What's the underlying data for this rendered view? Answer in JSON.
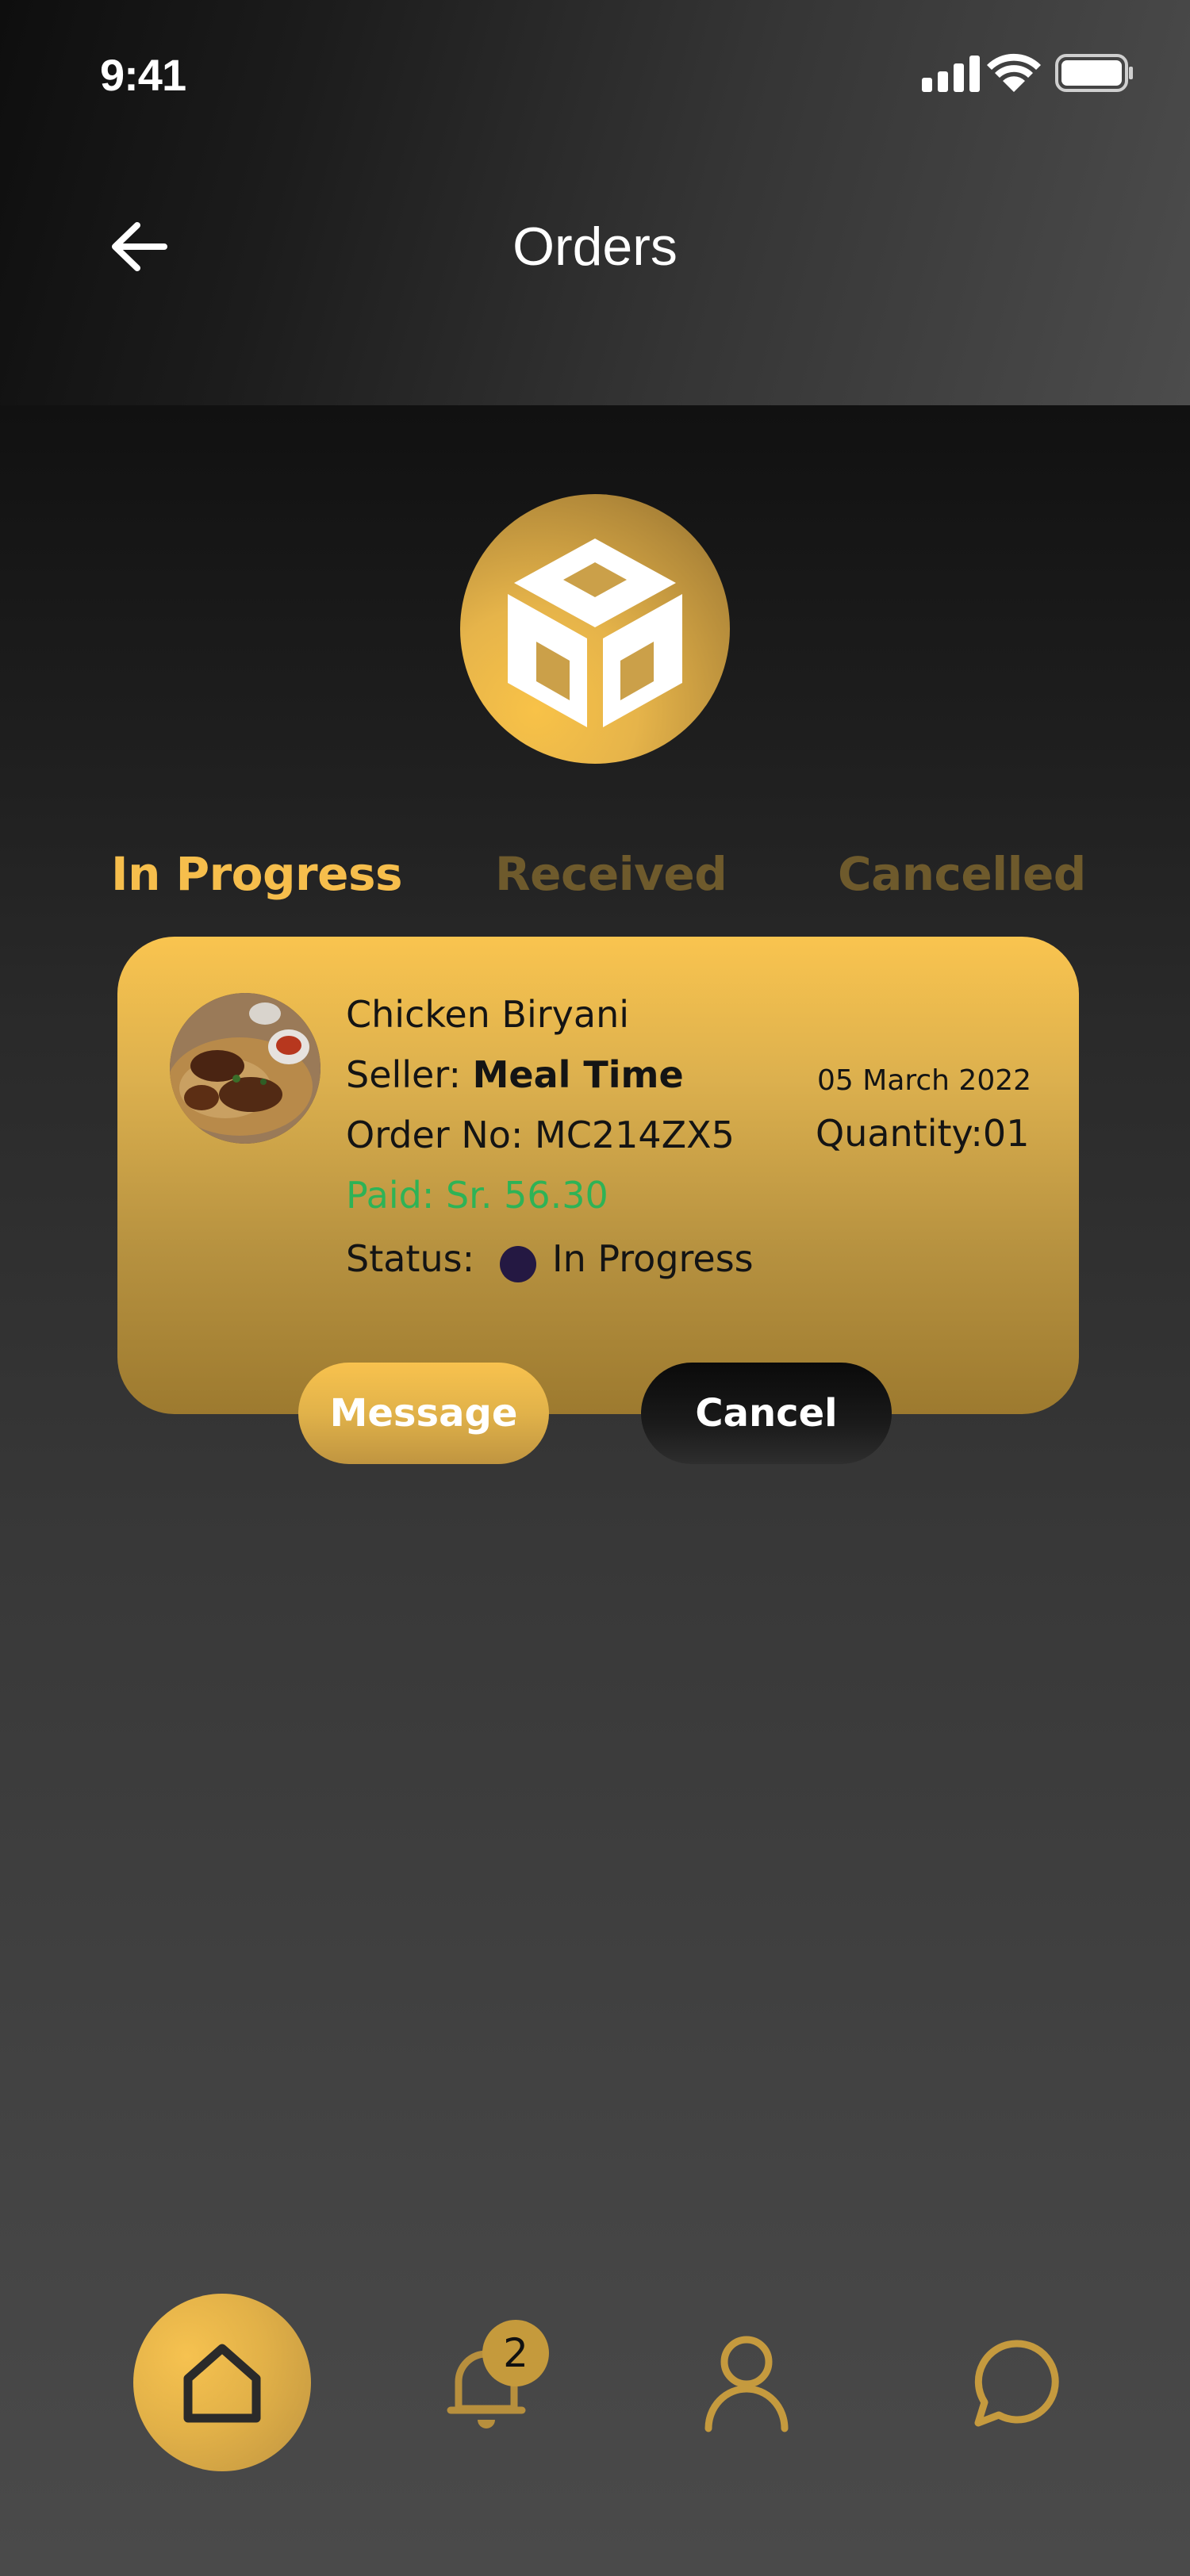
{
  "status_bar": {
    "time": "9:41",
    "icons": [
      "signal-icon",
      "wifi-icon",
      "battery-icon"
    ]
  },
  "header": {
    "title": "Orders",
    "back_icon": "arrow-left-icon"
  },
  "hero": {
    "icon": "box-icon"
  },
  "tabs": [
    {
      "label": "In Progress",
      "active": true
    },
    {
      "label": "Received",
      "active": false
    },
    {
      "label": "Cancelled",
      "active": false
    }
  ],
  "order": {
    "item_name": "Chicken Biryani",
    "seller_label": "Seller:",
    "seller_name": "Meal Time",
    "order_no": "Order No: MC214ZX5",
    "paid": "Paid: Sr. 56.30",
    "status_label": "Status:",
    "status_value": "In Progress",
    "date": "05 March 2022",
    "quantity": "Quantity:01"
  },
  "actions": {
    "message_label": "Message",
    "cancel_label": "Cancel"
  },
  "bottom_nav": {
    "items": [
      "home-icon",
      "bell-icon",
      "user-icon",
      "chat-icon"
    ],
    "notification_count": "2"
  },
  "colors": {
    "accent": "#f6be4c",
    "paid": "#2eb356",
    "status_dot": "#241842"
  }
}
